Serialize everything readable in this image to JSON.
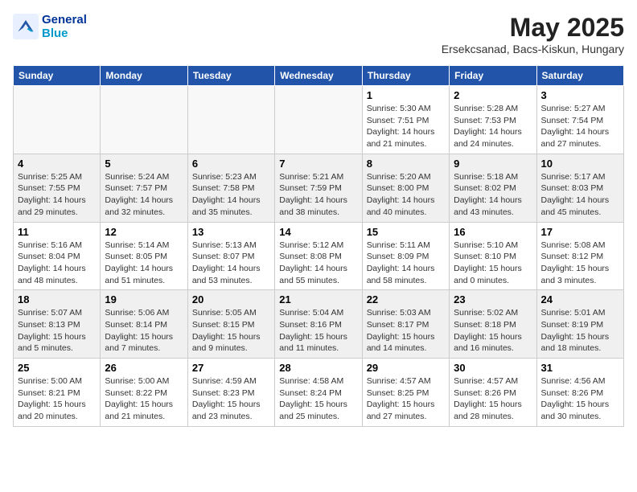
{
  "header": {
    "logo_line1": "General",
    "logo_line2": "Blue",
    "month_year": "May 2025",
    "location": "Ersekcsanad, Bacs-Kiskun, Hungary"
  },
  "weekdays": [
    "Sunday",
    "Monday",
    "Tuesday",
    "Wednesday",
    "Thursday",
    "Friday",
    "Saturday"
  ],
  "weeks": [
    [
      {
        "day": "",
        "info": ""
      },
      {
        "day": "",
        "info": ""
      },
      {
        "day": "",
        "info": ""
      },
      {
        "day": "",
        "info": ""
      },
      {
        "day": "1",
        "info": "Sunrise: 5:30 AM\nSunset: 7:51 PM\nDaylight: 14 hours\nand 21 minutes."
      },
      {
        "day": "2",
        "info": "Sunrise: 5:28 AM\nSunset: 7:53 PM\nDaylight: 14 hours\nand 24 minutes."
      },
      {
        "day": "3",
        "info": "Sunrise: 5:27 AM\nSunset: 7:54 PM\nDaylight: 14 hours\nand 27 minutes."
      }
    ],
    [
      {
        "day": "4",
        "info": "Sunrise: 5:25 AM\nSunset: 7:55 PM\nDaylight: 14 hours\nand 29 minutes."
      },
      {
        "day": "5",
        "info": "Sunrise: 5:24 AM\nSunset: 7:57 PM\nDaylight: 14 hours\nand 32 minutes."
      },
      {
        "day": "6",
        "info": "Sunrise: 5:23 AM\nSunset: 7:58 PM\nDaylight: 14 hours\nand 35 minutes."
      },
      {
        "day": "7",
        "info": "Sunrise: 5:21 AM\nSunset: 7:59 PM\nDaylight: 14 hours\nand 38 minutes."
      },
      {
        "day": "8",
        "info": "Sunrise: 5:20 AM\nSunset: 8:00 PM\nDaylight: 14 hours\nand 40 minutes."
      },
      {
        "day": "9",
        "info": "Sunrise: 5:18 AM\nSunset: 8:02 PM\nDaylight: 14 hours\nand 43 minutes."
      },
      {
        "day": "10",
        "info": "Sunrise: 5:17 AM\nSunset: 8:03 PM\nDaylight: 14 hours\nand 45 minutes."
      }
    ],
    [
      {
        "day": "11",
        "info": "Sunrise: 5:16 AM\nSunset: 8:04 PM\nDaylight: 14 hours\nand 48 minutes."
      },
      {
        "day": "12",
        "info": "Sunrise: 5:14 AM\nSunset: 8:05 PM\nDaylight: 14 hours\nand 51 minutes."
      },
      {
        "day": "13",
        "info": "Sunrise: 5:13 AM\nSunset: 8:07 PM\nDaylight: 14 hours\nand 53 minutes."
      },
      {
        "day": "14",
        "info": "Sunrise: 5:12 AM\nSunset: 8:08 PM\nDaylight: 14 hours\nand 55 minutes."
      },
      {
        "day": "15",
        "info": "Sunrise: 5:11 AM\nSunset: 8:09 PM\nDaylight: 14 hours\nand 58 minutes."
      },
      {
        "day": "16",
        "info": "Sunrise: 5:10 AM\nSunset: 8:10 PM\nDaylight: 15 hours\nand 0 minutes."
      },
      {
        "day": "17",
        "info": "Sunrise: 5:08 AM\nSunset: 8:12 PM\nDaylight: 15 hours\nand 3 minutes."
      }
    ],
    [
      {
        "day": "18",
        "info": "Sunrise: 5:07 AM\nSunset: 8:13 PM\nDaylight: 15 hours\nand 5 minutes."
      },
      {
        "day": "19",
        "info": "Sunrise: 5:06 AM\nSunset: 8:14 PM\nDaylight: 15 hours\nand 7 minutes."
      },
      {
        "day": "20",
        "info": "Sunrise: 5:05 AM\nSunset: 8:15 PM\nDaylight: 15 hours\nand 9 minutes."
      },
      {
        "day": "21",
        "info": "Sunrise: 5:04 AM\nSunset: 8:16 PM\nDaylight: 15 hours\nand 11 minutes."
      },
      {
        "day": "22",
        "info": "Sunrise: 5:03 AM\nSunset: 8:17 PM\nDaylight: 15 hours\nand 14 minutes."
      },
      {
        "day": "23",
        "info": "Sunrise: 5:02 AM\nSunset: 8:18 PM\nDaylight: 15 hours\nand 16 minutes."
      },
      {
        "day": "24",
        "info": "Sunrise: 5:01 AM\nSunset: 8:19 PM\nDaylight: 15 hours\nand 18 minutes."
      }
    ],
    [
      {
        "day": "25",
        "info": "Sunrise: 5:00 AM\nSunset: 8:21 PM\nDaylight: 15 hours\nand 20 minutes."
      },
      {
        "day": "26",
        "info": "Sunrise: 5:00 AM\nSunset: 8:22 PM\nDaylight: 15 hours\nand 21 minutes."
      },
      {
        "day": "27",
        "info": "Sunrise: 4:59 AM\nSunset: 8:23 PM\nDaylight: 15 hours\nand 23 minutes."
      },
      {
        "day": "28",
        "info": "Sunrise: 4:58 AM\nSunset: 8:24 PM\nDaylight: 15 hours\nand 25 minutes."
      },
      {
        "day": "29",
        "info": "Sunrise: 4:57 AM\nSunset: 8:25 PM\nDaylight: 15 hours\nand 27 minutes."
      },
      {
        "day": "30",
        "info": "Sunrise: 4:57 AM\nSunset: 8:26 PM\nDaylight: 15 hours\nand 28 minutes."
      },
      {
        "day": "31",
        "info": "Sunrise: 4:56 AM\nSunset: 8:26 PM\nDaylight: 15 hours\nand 30 minutes."
      }
    ]
  ]
}
